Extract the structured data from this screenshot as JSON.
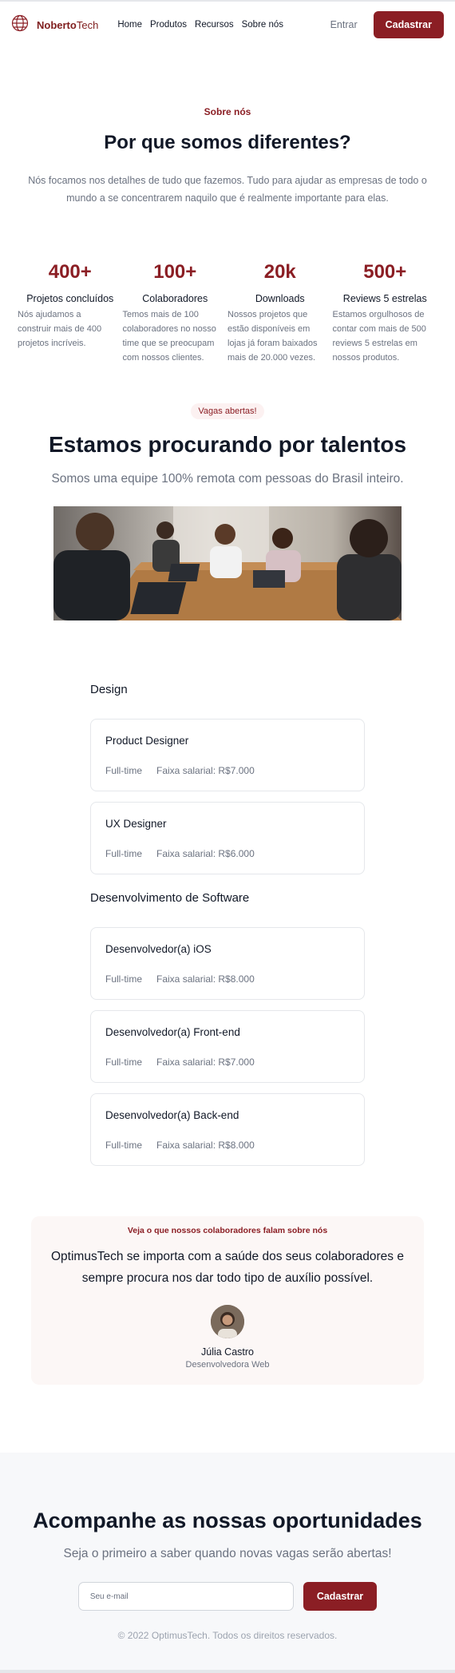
{
  "brand": {
    "name_bold": "Noberto",
    "name_light": "Tech"
  },
  "nav": {
    "items": [
      "Home",
      "Produtos",
      "Recursos",
      "Sobre nós"
    ]
  },
  "header": {
    "login_label": "Entrar",
    "signup_label": "Cadastrar"
  },
  "about": {
    "eyebrow": "Sobre nós",
    "title": "Por que somos diferentes?",
    "description": "Nós focamos nos detalhes de tudo que fazemos. Tudo para ajudar as empresas de todo o mundo a se concentrarem naquilo que é realmente importante para elas."
  },
  "stats": [
    {
      "number": "400+",
      "title": "Projetos concluídos",
      "description": "Nós ajudamos a construir mais de 400 projetos incríveis."
    },
    {
      "number": "100+",
      "title": "Colaboradores",
      "description": "Temos mais de 100 colaboradores no nosso time que se preocupam com nossos clientes."
    },
    {
      "number": "20k",
      "title": "Downloads",
      "description": "Nossos projetos que estão disponíveis em lojas já foram baixados mais de 20.000 vezes."
    },
    {
      "number": "500+",
      "title": "Reviews 5 estrelas",
      "description": "Estamos orgulhosos de contar com mais de 500 reviews 5 estrelas em nossos produtos."
    }
  ],
  "talents": {
    "pill": "Vagas abertas!",
    "title": "Estamos procurando por talentos",
    "subtitle": "Somos uma equipe 100% remota com pessoas do Brasil inteiro."
  },
  "jobs": {
    "departments": [
      {
        "name": "Design",
        "positions": [
          {
            "title": "Product Designer",
            "type": "Full-time",
            "salary": "Faixa salarial: R$7.000"
          },
          {
            "title": "UX Designer",
            "type": "Full-time",
            "salary": "Faixa salarial: R$6.000"
          }
        ]
      },
      {
        "name": "Desenvolvimento de Software",
        "positions": [
          {
            "title": "Desenvolvedor(a) iOS",
            "type": "Full-time",
            "salary": "Faixa salarial: R$8.000"
          },
          {
            "title": "Desenvolvedor(a) Front-end",
            "type": "Full-time",
            "salary": "Faixa salarial: R$7.000"
          },
          {
            "title": "Desenvolvedor(a) Back-end",
            "type": "Full-time",
            "salary": "Faixa salarial: R$8.000"
          }
        ]
      }
    ]
  },
  "testimonial": {
    "label": "Veja o que nossos colaboradores falam sobre nós",
    "quote": "OptimusTech se importa com a saúde dos seus colaboradores e sempre procura nos dar todo tipo de auxílio possível.",
    "name": "Júlia Castro",
    "role": "Desenvolvedora Web"
  },
  "newsletter": {
    "title": "Acompanhe as nossas oportunidades",
    "subtitle": "Seja o primeiro a saber quando novas vagas serão abertas!",
    "email_placeholder": "Seu e-mail",
    "button_label": "Cadastrar"
  },
  "footer": {
    "copyright": "© 2022 OptimusTech. Todos os direitos reservados."
  },
  "colors": {
    "accent": "#8b1e24",
    "muted": "#6b7280",
    "footer_bg": "#f7f8fa",
    "testimonial_bg": "#fcf7f6"
  }
}
